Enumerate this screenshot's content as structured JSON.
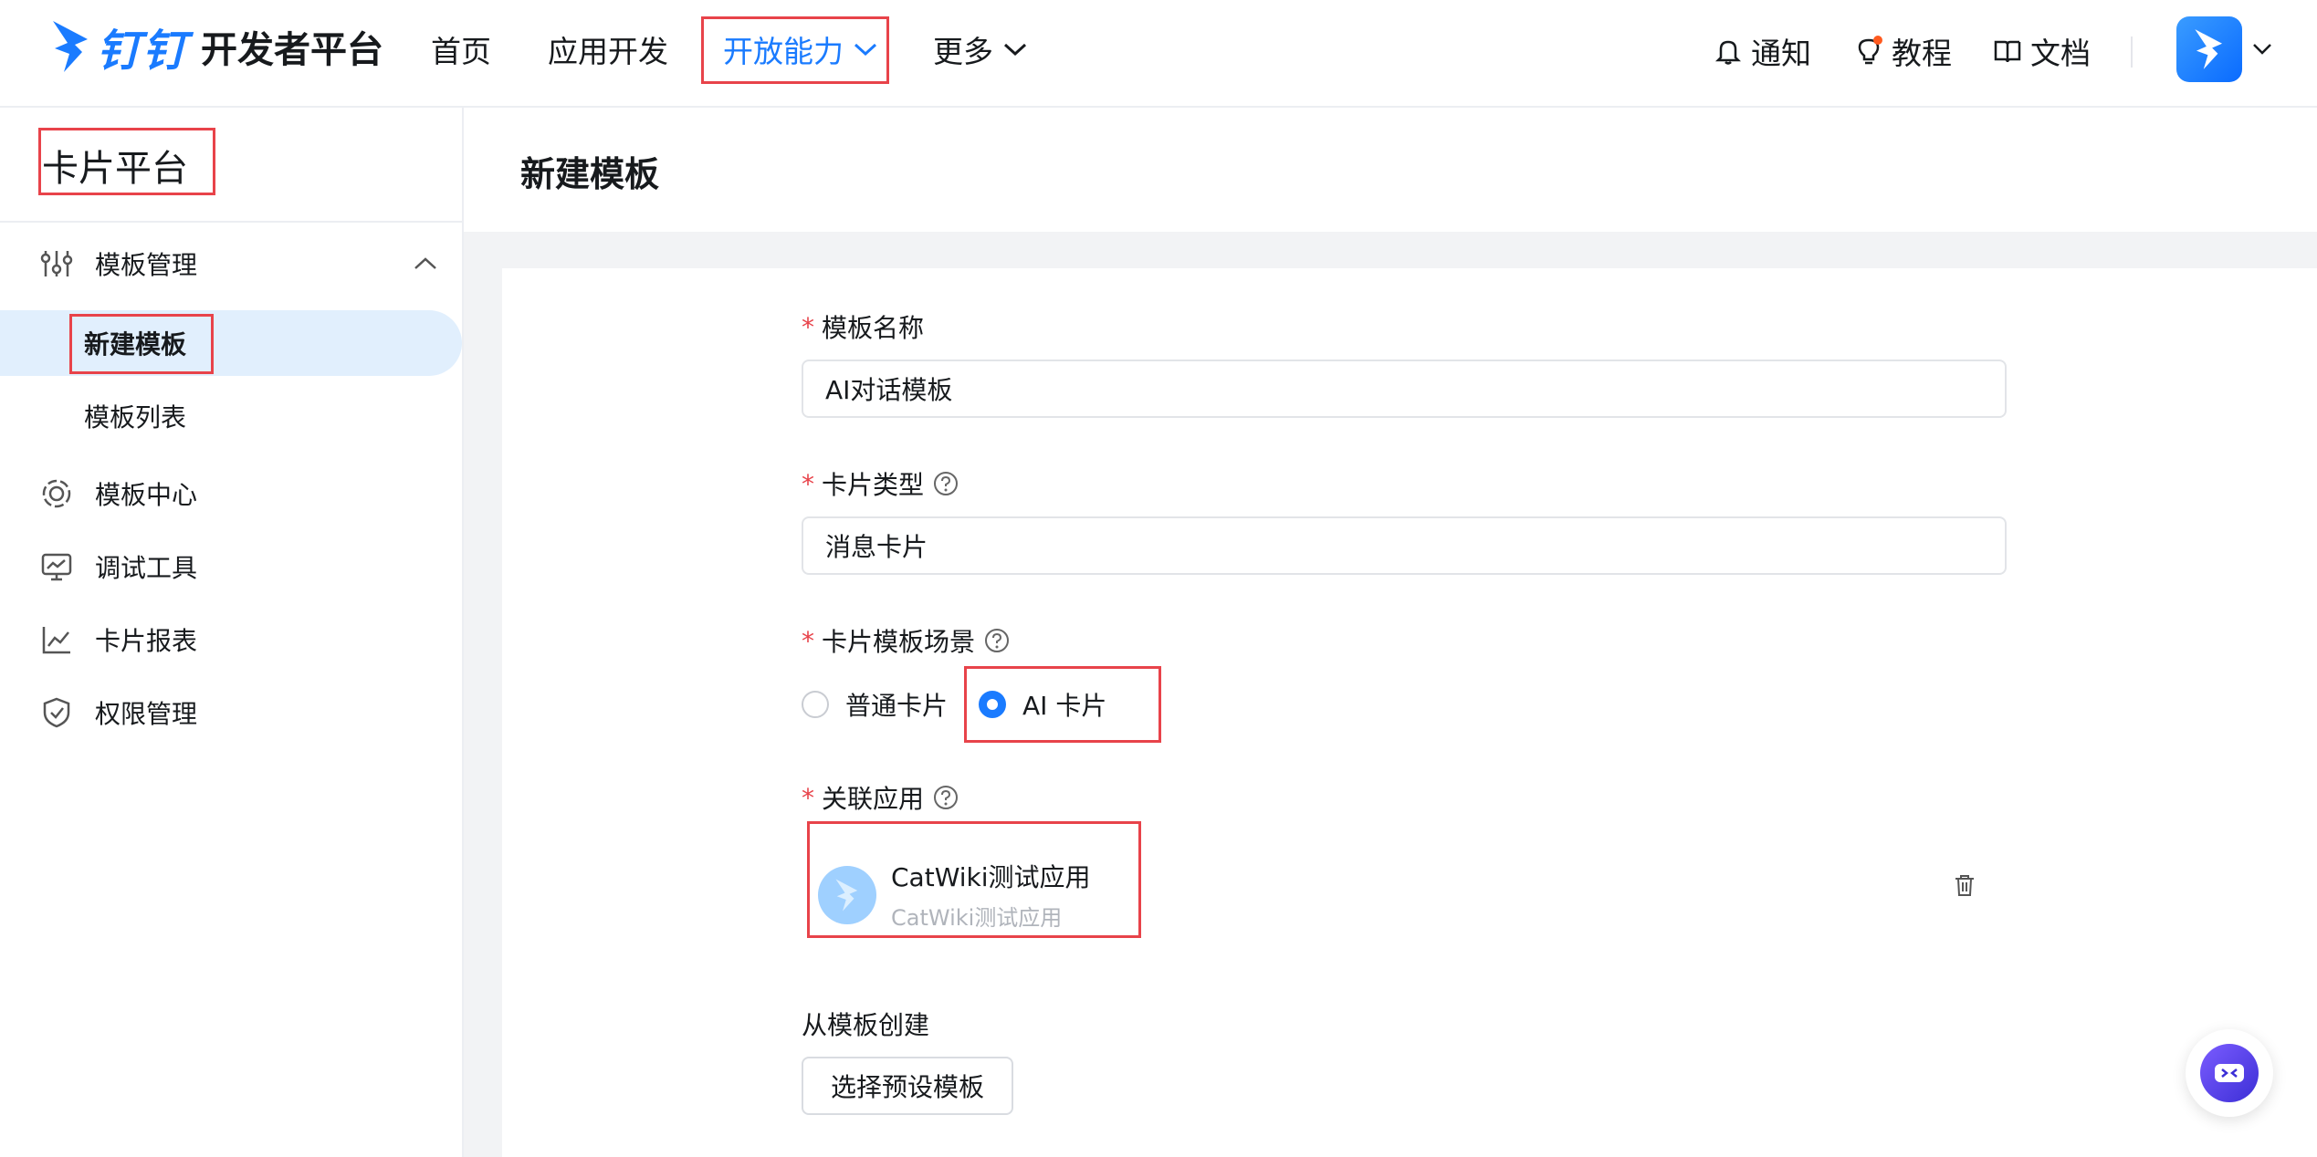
{
  "header": {
    "brand": "钉钉",
    "brand_sub": "开发者平台",
    "nav": [
      {
        "label": "首页"
      },
      {
        "label": "应用开发"
      },
      {
        "label": "开放能力",
        "active": true
      },
      {
        "label": "更多"
      }
    ],
    "actions": {
      "notify": "通知",
      "tutorial": "教程",
      "docs": "文档"
    }
  },
  "sidebar": {
    "title": "卡片平台",
    "groups": [
      {
        "label": "模板管理",
        "icon": "sliders-icon",
        "expanded": true,
        "children": [
          {
            "label": "新建模板",
            "active": true
          },
          {
            "label": "模板列表"
          }
        ]
      },
      {
        "label": "模板中心",
        "icon": "target-icon"
      },
      {
        "label": "调试工具",
        "icon": "monitor-icon"
      },
      {
        "label": "卡片报表",
        "icon": "line-chart-icon"
      },
      {
        "label": "权限管理",
        "icon": "shield-check-icon"
      }
    ]
  },
  "main": {
    "title": "新建模板",
    "form": {
      "name": {
        "label": "模板名称",
        "value": "AI对话模板"
      },
      "type": {
        "label": "卡片类型",
        "value": "消息卡片"
      },
      "scene": {
        "label": "卡片模板场景",
        "options": [
          "普通卡片",
          "AI 卡片"
        ],
        "selected": "AI 卡片"
      },
      "app": {
        "label": "关联应用",
        "name": "CatWiki测试应用",
        "sub": "CatWiki测试应用"
      },
      "from_template": {
        "label": "从模板创建",
        "button": "选择预设模板"
      }
    }
  },
  "colors": {
    "accent": "#1a7bff",
    "highlight": "#e8434a",
    "required": "#e8434a"
  }
}
